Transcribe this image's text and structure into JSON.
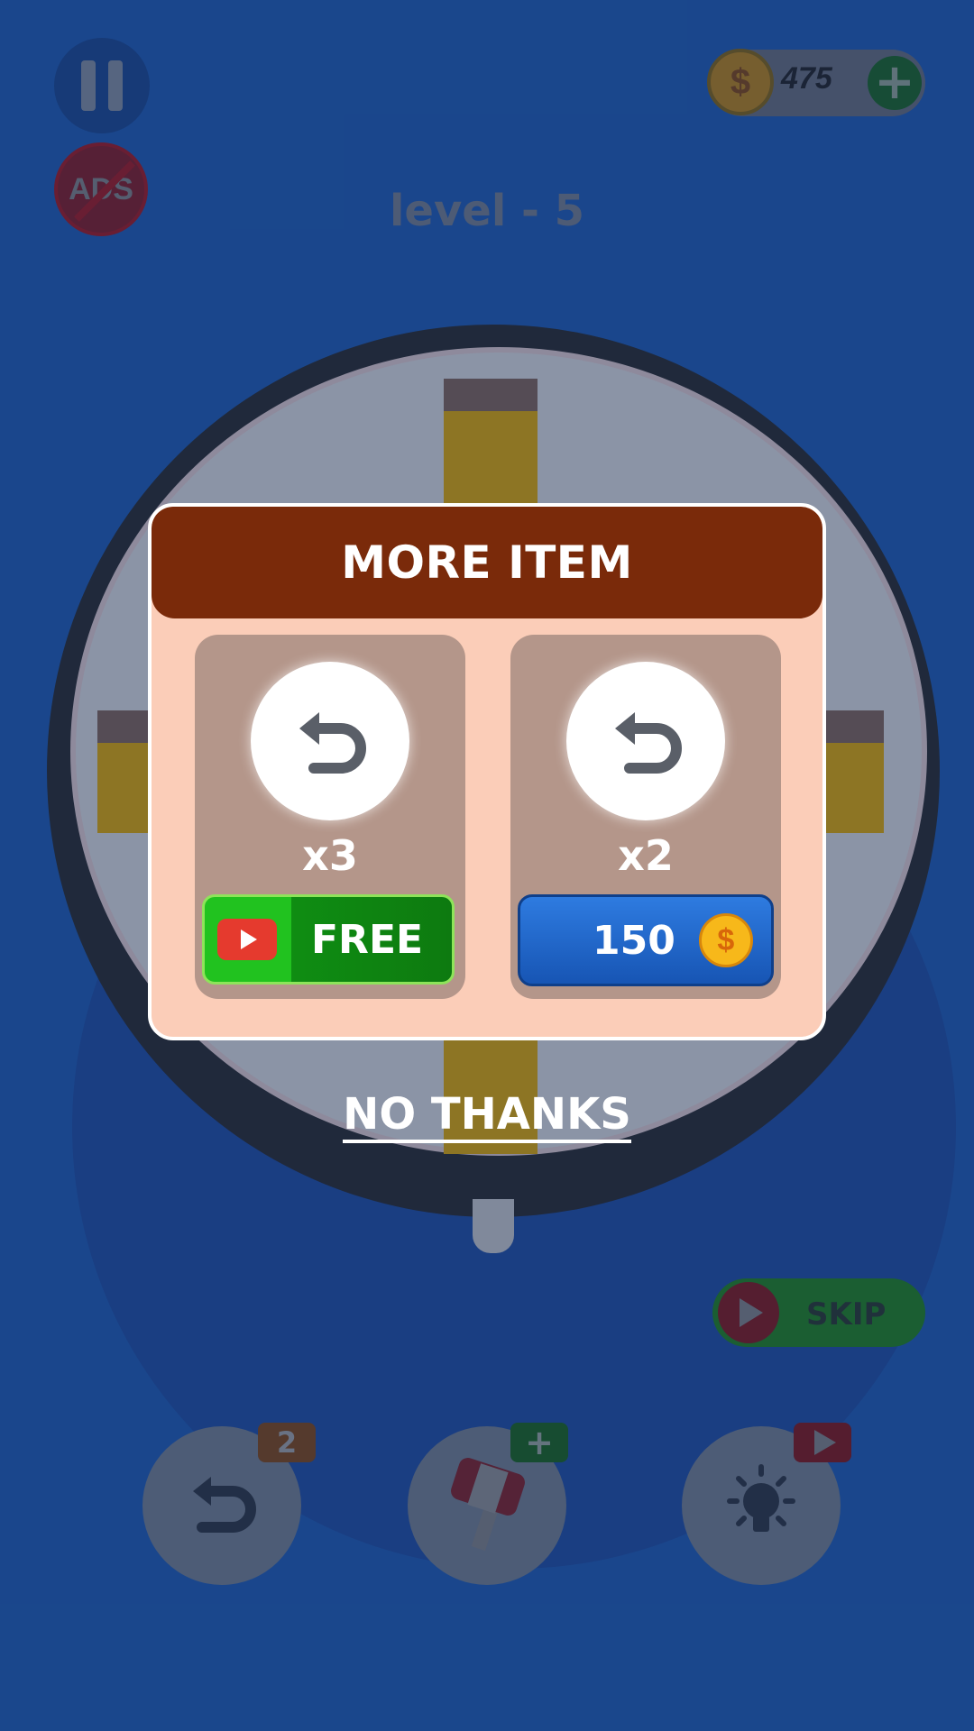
{
  "hud": {
    "coins": "475",
    "level": "level - 5",
    "no_ads_label": "ADS",
    "coin_symbol": "$",
    "plus_symbol": "+"
  },
  "dialog": {
    "title": "MORE ITEM",
    "options": [
      {
        "icon": "undo-icon",
        "quantity": "x3",
        "button_label": "FREE",
        "button_type": "watch-video"
      },
      {
        "icon": "undo-icon",
        "quantity": "x2",
        "button_label": "150",
        "button_type": "coin-purchase",
        "currency_symbol": "$"
      }
    ],
    "dismiss_label": "NO THANKS"
  },
  "controls": {
    "skip_label": "SKIP",
    "undo_count": "2",
    "hammer_badge": "+"
  },
  "colors": {
    "background": "#1f60be",
    "modal": "#fbcdb8",
    "header": "#7a2a0a",
    "free_button": "#21c21f",
    "coin_button": "#1f6bd0"
  }
}
